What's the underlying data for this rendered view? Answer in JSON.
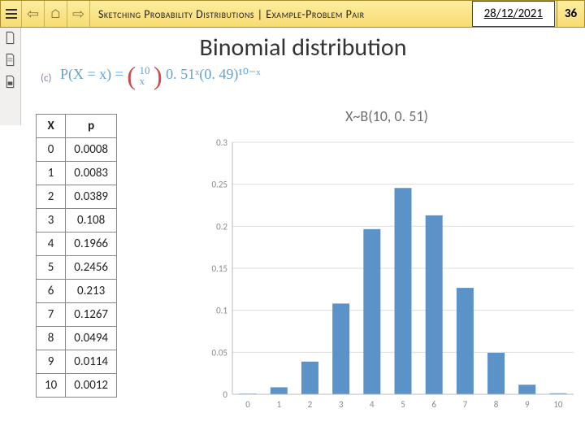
{
  "header": {
    "title": "Sketching Probability Distributions | Example-Problem Pair",
    "date": "28/12/2021",
    "page": "36"
  },
  "slide": {
    "title": "Binomial distribution",
    "part": "(c)",
    "formula_lhs": "P(X = x) =",
    "formula_n": "10",
    "formula_k": "x",
    "formula_rhs": "0. 51ˣ(0. 49)¹⁰⁻ˣ"
  },
  "table": {
    "cols": [
      "X",
      "p"
    ],
    "rows": [
      [
        "0",
        "0.0008"
      ],
      [
        "1",
        "0.0083"
      ],
      [
        "2",
        "0.0389"
      ],
      [
        "3",
        "0.108"
      ],
      [
        "4",
        "0.1966"
      ],
      [
        "5",
        "0.2456"
      ],
      [
        "6",
        "0.213"
      ],
      [
        "7",
        "0.1267"
      ],
      [
        "8",
        "0.0494"
      ],
      [
        "9",
        "0.0114"
      ],
      [
        "10",
        "0.0012"
      ]
    ]
  },
  "chart_data": {
    "type": "bar",
    "title": "X~B(10, 0. 51)",
    "categories": [
      "0",
      "1",
      "2",
      "3",
      "4",
      "5",
      "6",
      "7",
      "8",
      "9",
      "10"
    ],
    "values": [
      0.0008,
      0.0083,
      0.0389,
      0.108,
      0.1966,
      0.2456,
      0.213,
      0.1267,
      0.0494,
      0.0114,
      0.0012
    ],
    "ylim": [
      0,
      0.3
    ],
    "yticks": [
      0,
      0.05,
      0.1,
      0.15,
      0.2,
      0.25,
      0.3
    ],
    "xlabel": "",
    "ylabel": ""
  }
}
